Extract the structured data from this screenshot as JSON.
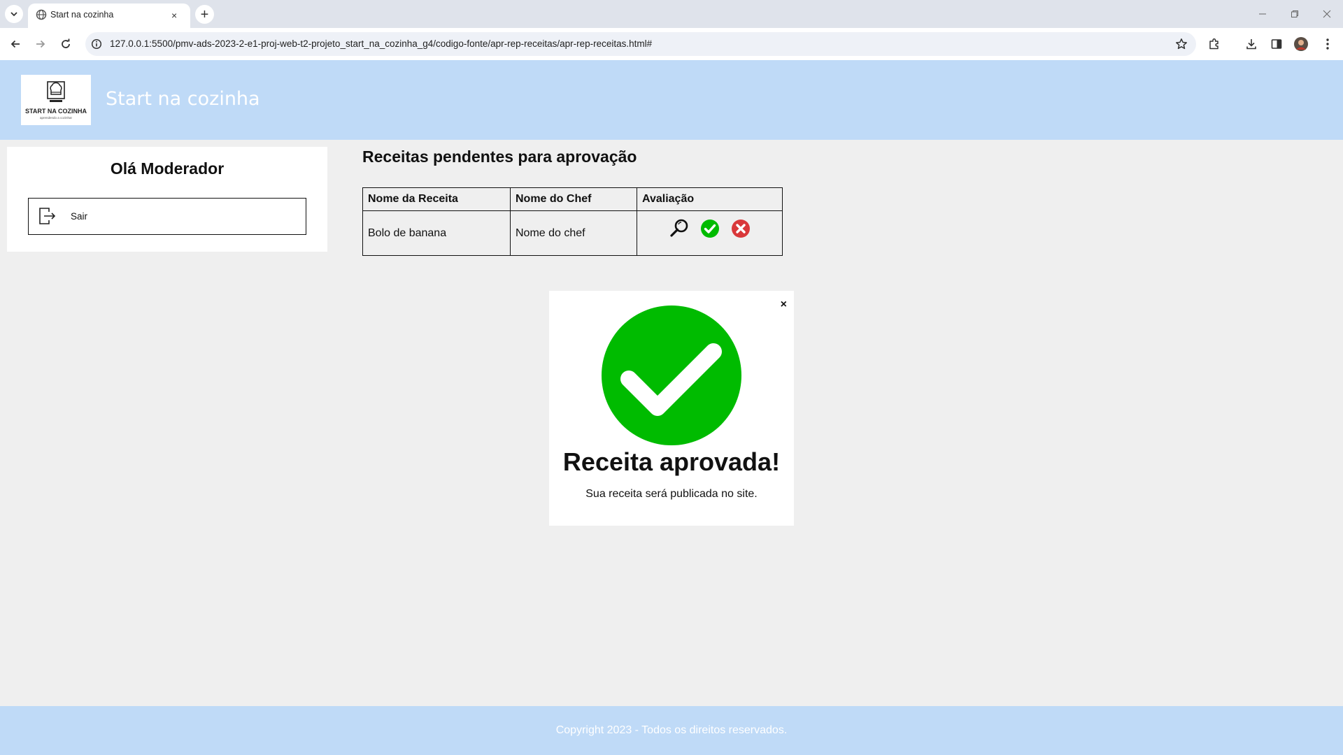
{
  "browser": {
    "tab_title": "Start na cozinha",
    "tab_close": "×",
    "new_tab": "+",
    "url": "127.0.0.1:5500/pmv-ads-2023-2-e1-proj-web-t2-projeto_start_na_cozinha_g4/codigo-fonte/apr-rep-receitas/apr-rep-receitas.html#",
    "icons": [
      "tab-search-icon",
      "globe-icon",
      "back-icon",
      "forward-icon",
      "reload-icon",
      "info-icon",
      "star-icon",
      "extensions-icon",
      "download-icon",
      "side-panel-icon",
      "profile-avatar-icon",
      "more-menu-icon",
      "minimize-icon",
      "restore-icon",
      "close-window-icon"
    ]
  },
  "header": {
    "site_title": "Start na cozinha",
    "logo_text": "START NA COZINHA",
    "logo_tagline": "aprendendo a cozinhar"
  },
  "sidebar": {
    "greeting": "Olá Moderador",
    "logout_label": "Sair"
  },
  "main": {
    "title": "Receitas pendentes para aprovação",
    "table": {
      "headers": [
        "Nome da Receita",
        "Nome do Chef",
        "Avaliação"
      ],
      "rows": [
        {
          "recipe": "Bolo de banana",
          "chef": "Nome do chef",
          "actions": [
            "search-icon",
            "approve-icon",
            "reject-icon"
          ]
        }
      ]
    }
  },
  "modal": {
    "close": "×",
    "title": "Receita aprovada!",
    "text": "Sua receita será publicada no site."
  },
  "footer": {
    "copyright": "Copyright 2023 - Todos os direitos reservados."
  },
  "colors": {
    "header_bg": "#bfdaf7",
    "page_bg": "#efefef",
    "approve_green": "#00bb00",
    "reject_red": "#d9383a"
  }
}
